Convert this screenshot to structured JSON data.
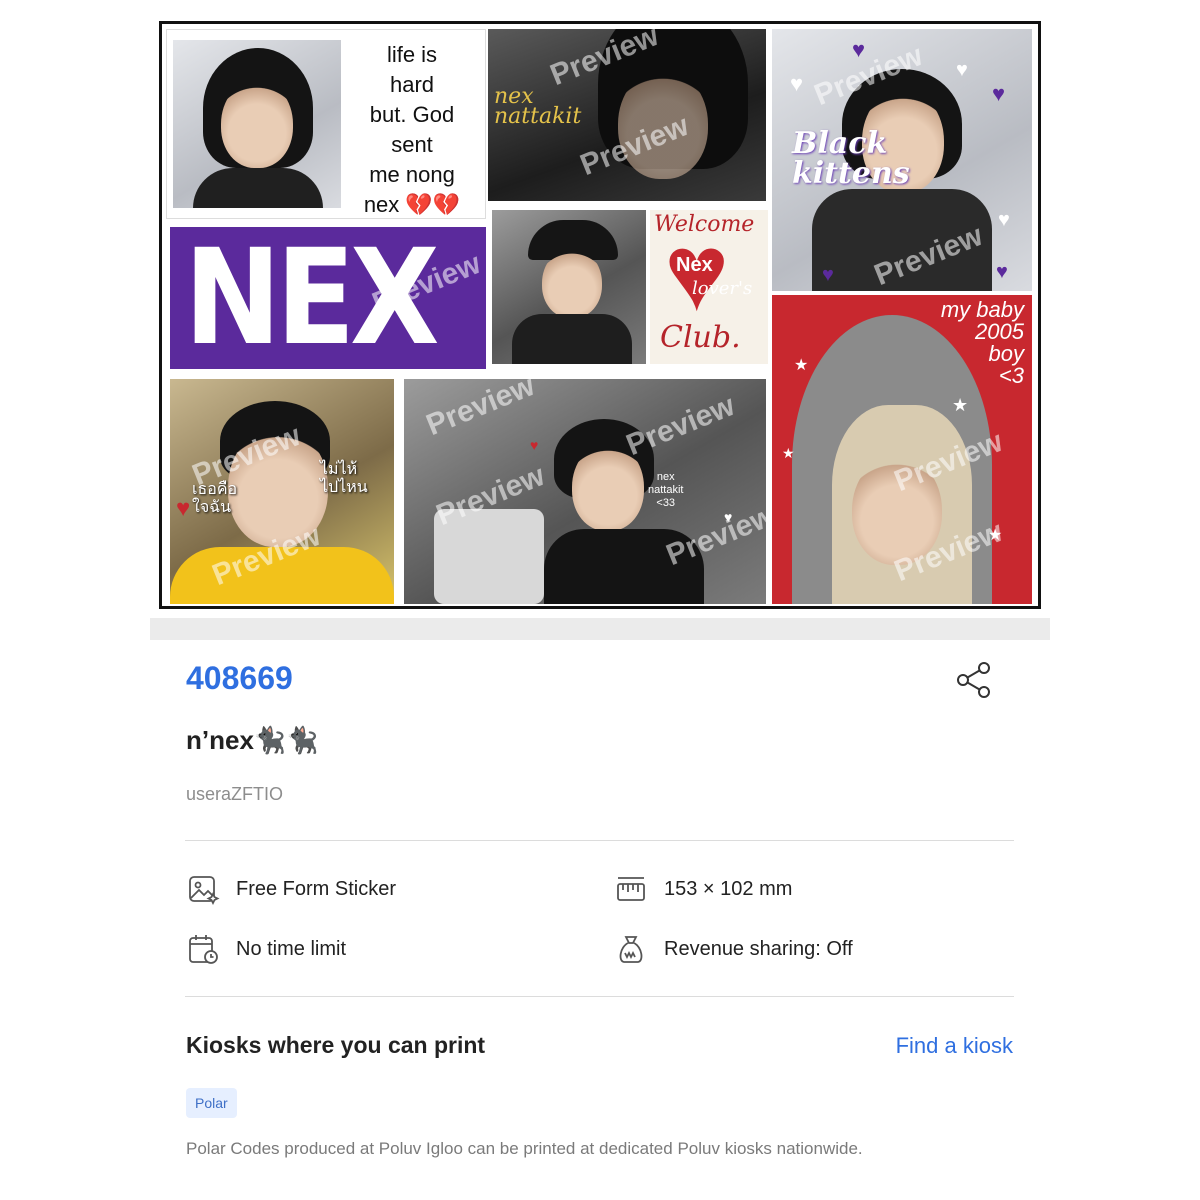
{
  "sticker": {
    "watermark": "Preview",
    "quote_lines": [
      "life is",
      "hard",
      "but. God",
      "sent",
      "me nong",
      "nex 💔💔"
    ],
    "nex_banner": "NEX !",
    "nex_nattakit_script": [
      "nex",
      "nattakit"
    ],
    "black_kittens": [
      "Black",
      "kittens"
    ],
    "welcome_club": [
      "Welcome",
      "Nex",
      "lover's",
      "Club."
    ],
    "my_baby": [
      "my baby",
      "2005",
      "boy",
      "<3"
    ],
    "thai_left": [
      "เธอคือ",
      "ใจฉัน"
    ],
    "thai_right": [
      "ไม่ไห้",
      "ไปไหน"
    ],
    "nex_small": [
      "nex",
      "nattakit",
      "<33"
    ]
  },
  "product": {
    "code": "408669",
    "title": "n’nex🐈‍⬛🐈‍⬛",
    "username": "useraZFTIO"
  },
  "specs": {
    "type": "Free Form Sticker",
    "size": "153 × 102 mm",
    "time": "No time limit",
    "revenue": "Revenue sharing: Off"
  },
  "icons": {
    "share": "share-icon",
    "type": "image-sparkle-icon",
    "size": "ruler-icon",
    "time": "calendar-clock-icon",
    "revenue": "money-bag-icon"
  },
  "kiosk": {
    "heading": "Kiosks where you can print",
    "link": "Find a kiosk",
    "badge": "Polar",
    "note": "Polar Codes produced at Poluv Igloo can be printed at dedicated Poluv kiosks nationwide."
  },
  "colors": {
    "accent": "#2f6fe0",
    "purple": "#5b2a9c",
    "red": "#c8282f"
  }
}
